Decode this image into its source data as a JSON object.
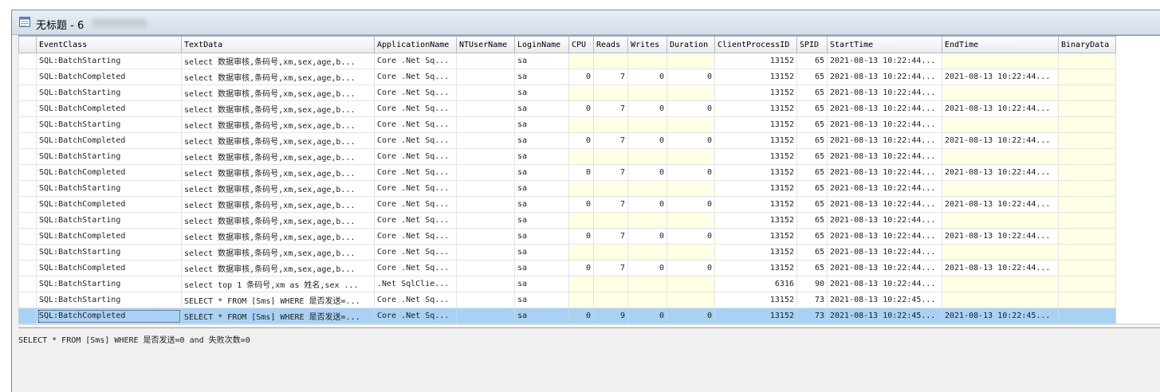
{
  "window": {
    "title": "无标题 - 6"
  },
  "columns": [
    "EventClass",
    "TextData",
    "ApplicationName",
    "NTUserName",
    "LoginName",
    "CPU",
    "Reads",
    "Writes",
    "Duration",
    "ClientProcessID",
    "SPID",
    "StartTime",
    "EndTime",
    "BinaryData"
  ],
  "rows": [
    {
      "event": "SQL:BatchStarting",
      "text": "select 数据审核,条码号,xm,sex,age,b...",
      "app": "Core .Net Sq...",
      "nt": "",
      "login": "sa",
      "cpu": "",
      "reads": "",
      "writes": "",
      "duration": "",
      "cpid": "13152",
      "spid": "65",
      "start": "2021-08-13 10:22:44...",
      "end": "",
      "binary": ""
    },
    {
      "event": "SQL:BatchCompleted",
      "text": "select 数据审核,条码号,xm,sex,age,b...",
      "app": "Core .Net Sq...",
      "nt": "",
      "login": "sa",
      "cpu": "0",
      "reads": "7",
      "writes": "0",
      "duration": "0",
      "cpid": "13152",
      "spid": "65",
      "start": "2021-08-13 10:22:44...",
      "end": "2021-08-13 10:22:44...",
      "binary": ""
    },
    {
      "event": "SQL:BatchStarting",
      "text": "select 数据审核,条码号,xm,sex,age,b...",
      "app": "Core .Net Sq...",
      "nt": "",
      "login": "sa",
      "cpu": "",
      "reads": "",
      "writes": "",
      "duration": "",
      "cpid": "13152",
      "spid": "65",
      "start": "2021-08-13 10:22:44...",
      "end": "",
      "binary": ""
    },
    {
      "event": "SQL:BatchCompleted",
      "text": "select 数据审核,条码号,xm,sex,age,b...",
      "app": "Core .Net Sq...",
      "nt": "",
      "login": "sa",
      "cpu": "0",
      "reads": "7",
      "writes": "0",
      "duration": "0",
      "cpid": "13152",
      "spid": "65",
      "start": "2021-08-13 10:22:44...",
      "end": "2021-08-13 10:22:44...",
      "binary": ""
    },
    {
      "event": "SQL:BatchStarting",
      "text": "select 数据审核,条码号,xm,sex,age,b...",
      "app": "Core .Net Sq...",
      "nt": "",
      "login": "sa",
      "cpu": "",
      "reads": "",
      "writes": "",
      "duration": "",
      "cpid": "13152",
      "spid": "65",
      "start": "2021-08-13 10:22:44...",
      "end": "",
      "binary": ""
    },
    {
      "event": "SQL:BatchCompleted",
      "text": "select 数据审核,条码号,xm,sex,age,b...",
      "app": "Core .Net Sq...",
      "nt": "",
      "login": "sa",
      "cpu": "0",
      "reads": "7",
      "writes": "0",
      "duration": "0",
      "cpid": "13152",
      "spid": "65",
      "start": "2021-08-13 10:22:44...",
      "end": "2021-08-13 10:22:44...",
      "binary": ""
    },
    {
      "event": "SQL:BatchStarting",
      "text": "select 数据审核,条码号,xm,sex,age,b...",
      "app": "Core .Net Sq...",
      "nt": "",
      "login": "sa",
      "cpu": "",
      "reads": "",
      "writes": "",
      "duration": "",
      "cpid": "13152",
      "spid": "65",
      "start": "2021-08-13 10:22:44...",
      "end": "",
      "binary": ""
    },
    {
      "event": "SQL:BatchCompleted",
      "text": "select 数据审核,条码号,xm,sex,age,b...",
      "app": "Core .Net Sq...",
      "nt": "",
      "login": "sa",
      "cpu": "0",
      "reads": "7",
      "writes": "0",
      "duration": "0",
      "cpid": "13152",
      "spid": "65",
      "start": "2021-08-13 10:22:44...",
      "end": "2021-08-13 10:22:44...",
      "binary": ""
    },
    {
      "event": "SQL:BatchStarting",
      "text": "select 数据审核,条码号,xm,sex,age,b...",
      "app": "Core .Net Sq...",
      "nt": "",
      "login": "sa",
      "cpu": "",
      "reads": "",
      "writes": "",
      "duration": "",
      "cpid": "13152",
      "spid": "65",
      "start": "2021-08-13 10:22:44...",
      "end": "",
      "binary": ""
    },
    {
      "event": "SQL:BatchCompleted",
      "text": "select 数据审核,条码号,xm,sex,age,b...",
      "app": "Core .Net Sq...",
      "nt": "",
      "login": "sa",
      "cpu": "0",
      "reads": "7",
      "writes": "0",
      "duration": "0",
      "cpid": "13152",
      "spid": "65",
      "start": "2021-08-13 10:22:44...",
      "end": "2021-08-13 10:22:44...",
      "binary": ""
    },
    {
      "event": "SQL:BatchStarting",
      "text": "select 数据审核,条码号,xm,sex,age,b...",
      "app": "Core .Net Sq...",
      "nt": "",
      "login": "sa",
      "cpu": "",
      "reads": "",
      "writes": "",
      "duration": "",
      "cpid": "13152",
      "spid": "65",
      "start": "2021-08-13 10:22:44...",
      "end": "",
      "binary": ""
    },
    {
      "event": "SQL:BatchCompleted",
      "text": "select 数据审核,条码号,xm,sex,age,b...",
      "app": "Core .Net Sq...",
      "nt": "",
      "login": "sa",
      "cpu": "0",
      "reads": "7",
      "writes": "0",
      "duration": "0",
      "cpid": "13152",
      "spid": "65",
      "start": "2021-08-13 10:22:44...",
      "end": "2021-08-13 10:22:44...",
      "binary": ""
    },
    {
      "event": "SQL:BatchStarting",
      "text": "select 数据审核,条码号,xm,sex,age,b...",
      "app": "Core .Net Sq...",
      "nt": "",
      "login": "sa",
      "cpu": "",
      "reads": "",
      "writes": "",
      "duration": "",
      "cpid": "13152",
      "spid": "65",
      "start": "2021-08-13 10:22:44...",
      "end": "",
      "binary": ""
    },
    {
      "event": "SQL:BatchCompleted",
      "text": "select 数据审核,条码号,xm,sex,age,b...",
      "app": "Core .Net Sq...",
      "nt": "",
      "login": "sa",
      "cpu": "0",
      "reads": "7",
      "writes": "0",
      "duration": "0",
      "cpid": "13152",
      "spid": "65",
      "start": "2021-08-13 10:22:44...",
      "end": "2021-08-13 10:22:44...",
      "binary": ""
    },
    {
      "event": "SQL:BatchStarting",
      "text": "select top 1 条码号,xm as 姓名,sex ...",
      "app": ".Net SqlClie...",
      "nt": "",
      "login": "sa",
      "cpu": "",
      "reads": "",
      "writes": "",
      "duration": "",
      "cpid": "6316",
      "spid": "90",
      "start": "2021-08-13 10:22:44...",
      "end": "",
      "binary": ""
    },
    {
      "event": "SQL:BatchStarting",
      "text": "SELECT * FROM [Sms] WHERE 是否发送=...",
      "app": "Core .Net Sq...",
      "nt": "",
      "login": "sa",
      "cpu": "",
      "reads": "",
      "writes": "",
      "duration": "",
      "cpid": "13152",
      "spid": "73",
      "start": "2021-08-13 10:22:45...",
      "end": "",
      "binary": ""
    },
    {
      "event": "SQL:BatchCompleted",
      "text": "SELECT * FROM [Sms] WHERE 是否发送=...",
      "app": "Core .Net Sq...",
      "nt": "",
      "login": "sa",
      "cpu": "0",
      "reads": "9",
      "writes": "0",
      "duration": "0",
      "cpid": "13152",
      "spid": "73",
      "start": "2021-08-13 10:22:45...",
      "end": "2021-08-13 10:22:45...",
      "binary": "",
      "selected": true
    }
  ],
  "detail": {
    "text": "SELECT * FROM [Sms] WHERE 是否发送=0 and 失败次数=0"
  },
  "colors": {
    "selected_row": "#a9d1f4",
    "empty_numeric_cell": "#ffffe5",
    "window_border": "#7a8ca5"
  }
}
